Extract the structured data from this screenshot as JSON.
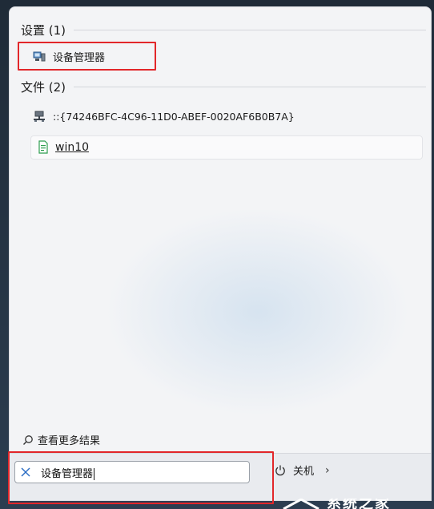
{
  "settings_section": {
    "header": "设置 (1)"
  },
  "settings_items": [
    {
      "label": "设备管理器",
      "icon": "device-manager-icon"
    }
  ],
  "files_section": {
    "header": "文件 (2)"
  },
  "file_items": [
    {
      "label": "::{74246BFC-4C96-11D0-ABEF-0020AF6B0B7A}",
      "icon": "network-drive-icon"
    },
    {
      "label": "win10",
      "icon": "document-icon"
    }
  ],
  "more_results": {
    "label": "查看更多结果",
    "icon": "search-icon"
  },
  "search": {
    "value": "设备管理器"
  },
  "power": {
    "label": "关机",
    "icon": "power-icon",
    "chevron": "›"
  },
  "watermark": {
    "text": "系统之家"
  },
  "colors": {
    "highlight": "#e2272a",
    "panel": "#f3f4f6"
  }
}
